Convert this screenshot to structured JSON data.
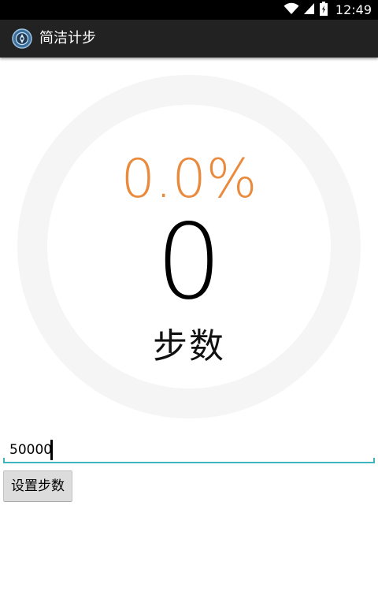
{
  "status_bar": {
    "time": "12:49",
    "icons": [
      "wifi-icon",
      "signal-icon",
      "battery-icon"
    ]
  },
  "app_bar": {
    "title": "简洁计步",
    "icon": "app-icon"
  },
  "progress": {
    "percent_text": "0.0%",
    "fraction": 0.0,
    "steps": "0",
    "steps_label": "步数"
  },
  "goal": {
    "input_value": "50000",
    "button_label": "设置步数"
  },
  "colors": {
    "percent": "#ea8a3d",
    "ring_track": "#f5f5f5",
    "input_underline": "#3fb4bf",
    "app_bar": "#222222"
  }
}
